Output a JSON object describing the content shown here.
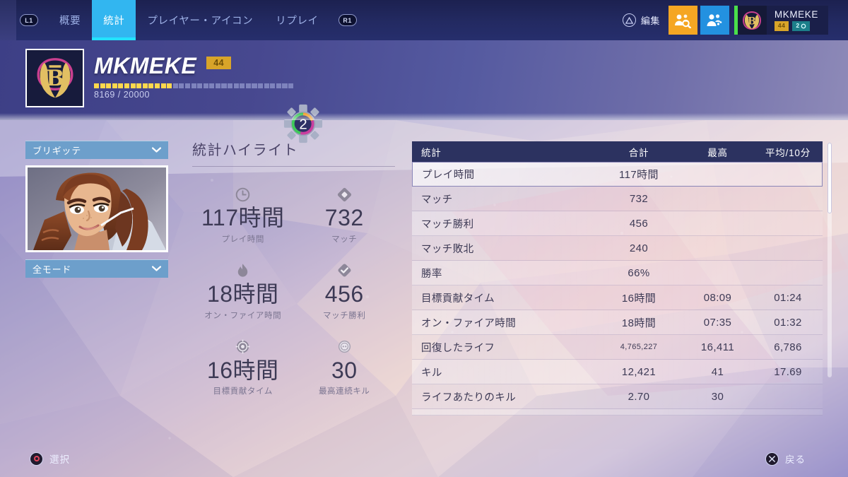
{
  "topnav": {
    "bumper_left": "L1",
    "bumper_right": "R1",
    "tabs": [
      {
        "label": "概要",
        "active": false
      },
      {
        "label": "統計",
        "active": true
      },
      {
        "label": "プレイヤー・アイコン",
        "active": false
      },
      {
        "label": "リプレイ",
        "active": false
      }
    ],
    "edit_label": "編集",
    "edit_button_icon": "triangle-button-icon",
    "group_search_icon": "group-search-icon",
    "group_icon": "group-add-icon",
    "player_name": "MKMEKE",
    "player_level_chip": "44",
    "player_endorse_chip": "2"
  },
  "banner": {
    "player_icon": "bastion-emblem-icon",
    "name": "MKMEKE",
    "level": "44",
    "xp_current": "8169",
    "xp_separator": "/",
    "xp_max": "20000",
    "xp_text": "8169 / 20000",
    "xp_filled_segments": 13,
    "xp_total_segments": 33,
    "endorsement_level": "2"
  },
  "hero_panel": {
    "hero_dropdown": "ブリギッテ",
    "mode_dropdown": "全モード",
    "hero_portrait": "brigitte-portrait"
  },
  "highlights": {
    "title": "統計ハイライト",
    "items": [
      {
        "icon": "clock-icon",
        "value": "117時間",
        "label": "プレイ時間"
      },
      {
        "icon": "diamond-icon",
        "value": "732",
        "label": "マッチ"
      },
      {
        "icon": "flame-icon",
        "value": "18時間",
        "label": "オン・ファイア時間"
      },
      {
        "icon": "checkmark-icon",
        "value": "456",
        "label": "マッチ勝利"
      },
      {
        "icon": "objective-icon",
        "value": "16時間",
        "label": "目標貢献タイム"
      },
      {
        "icon": "skull-icon",
        "value": "30",
        "label": "最高連続キル"
      }
    ]
  },
  "table": {
    "columns": [
      "統計",
      "合計",
      "最高",
      "平均/10分"
    ],
    "rows": [
      {
        "stat": "プレイ時間",
        "total": "117時間",
        "best": "",
        "avg": "",
        "selected": true,
        "small": false
      },
      {
        "stat": "マッチ",
        "total": "732",
        "best": "",
        "avg": "",
        "selected": false,
        "small": false
      },
      {
        "stat": "マッチ勝利",
        "total": "456",
        "best": "",
        "avg": "",
        "selected": false,
        "small": false
      },
      {
        "stat": "マッチ敗北",
        "total": "240",
        "best": "",
        "avg": "",
        "selected": false,
        "small": false
      },
      {
        "stat": "勝率",
        "total": "66%",
        "best": "",
        "avg": "",
        "selected": false,
        "small": false
      },
      {
        "stat": "目標貢献タイム",
        "total": "16時間",
        "best": "08:09",
        "avg": "01:24",
        "selected": false,
        "small": false
      },
      {
        "stat": "オン・ファイア時間",
        "total": "18時間",
        "best": "07:35",
        "avg": "01:32",
        "selected": false,
        "small": false
      },
      {
        "stat": "回復したライフ",
        "total": "4,765,227",
        "best": "16,411",
        "avg": "6,786",
        "selected": false,
        "small": true
      },
      {
        "stat": "キル",
        "total": "12,421",
        "best": "41",
        "avg": "17.69",
        "selected": false,
        "small": false
      },
      {
        "stat": "ライフあたりのキル",
        "total": "2.70",
        "best": "30",
        "avg": "",
        "selected": false,
        "small": false
      }
    ]
  },
  "bottombar": {
    "select_label": "選択",
    "select_icon": "circle-button-icon",
    "back_label": "戻る",
    "back_icon": "cross-button-icon"
  },
  "colors": {
    "accent_cyan": "#32b6f0",
    "accent_underline": "#23e3ff",
    "nav_bg": "#232a62",
    "table_header": "#2c3260",
    "level_gold": "#d8a429",
    "dropdown_blue": "#6d9fcb",
    "orange_button": "#f5a623",
    "blue_button": "#2391e0",
    "green_bar": "#4ae04a"
  }
}
